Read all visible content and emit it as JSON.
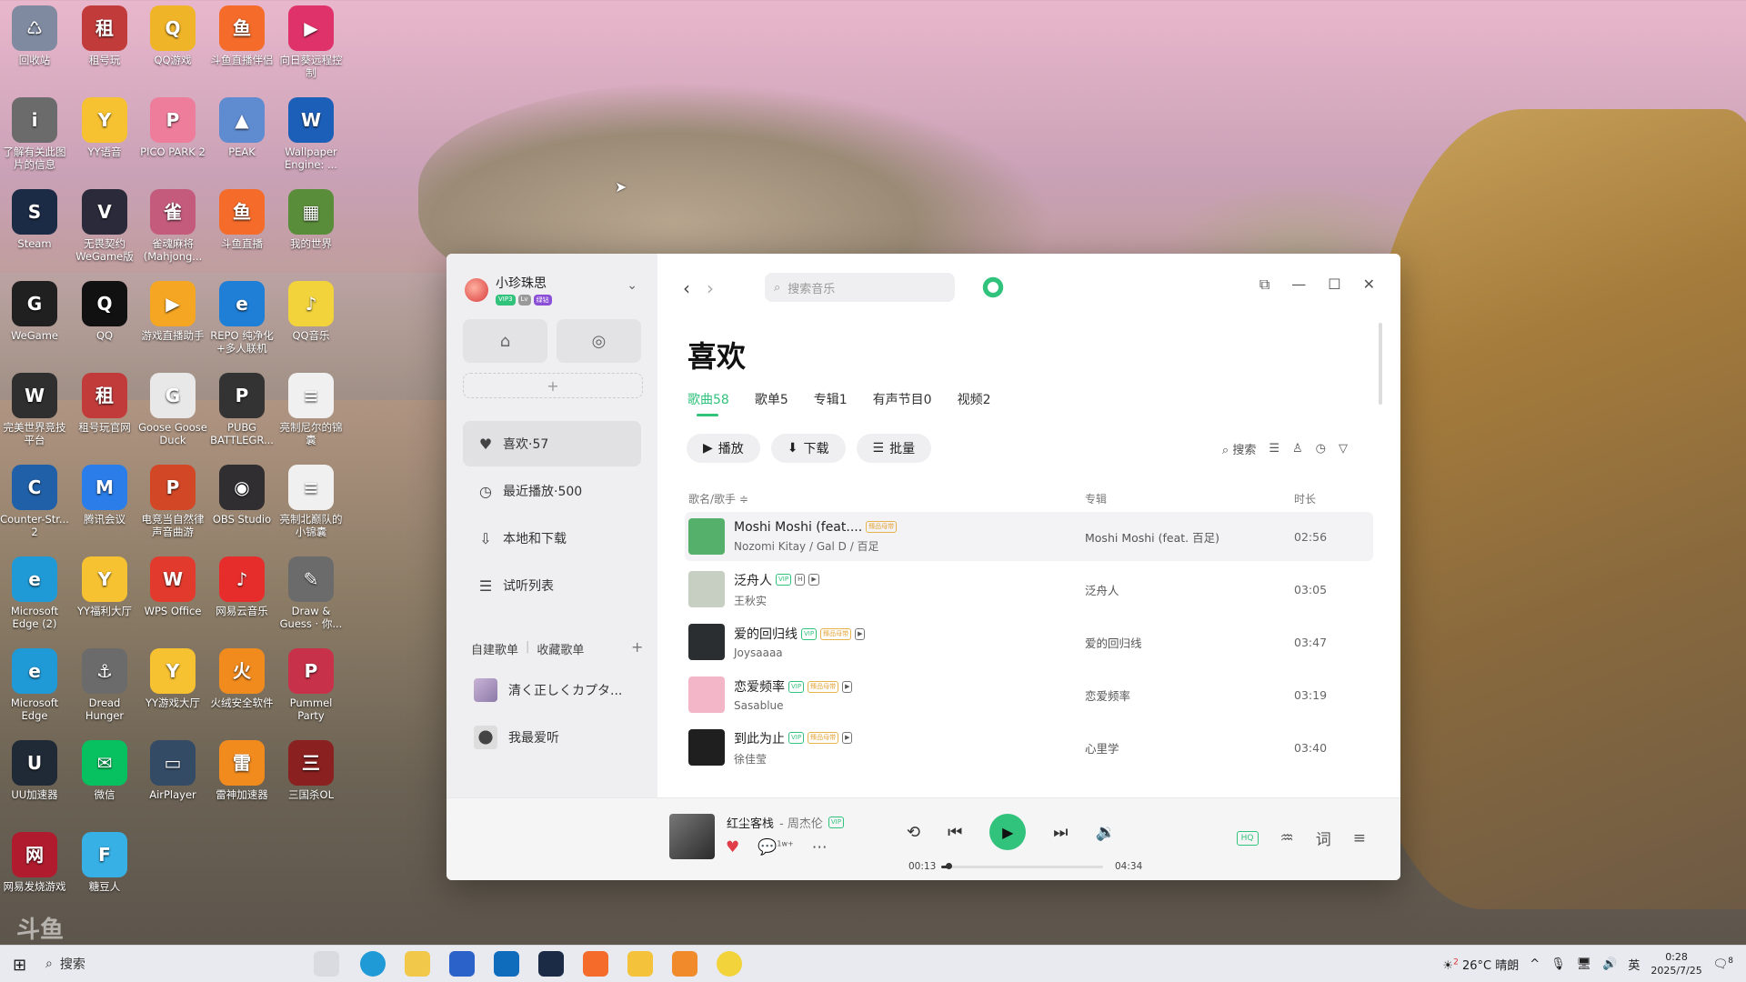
{
  "desktop": {
    "icons": [
      {
        "label": "回收站",
        "color": "#7f8aa1",
        "glyph": "♺"
      },
      {
        "label": "租号玩",
        "color": "#c23b3b",
        "glyph": "租"
      },
      {
        "label": "QQ游戏",
        "color": "#f0b429",
        "glyph": "Q"
      },
      {
        "label": "斗鱼直播伴侣",
        "color": "#f46b2a",
        "glyph": "鱼"
      },
      {
        "label": "向日葵远程控制",
        "color": "#e0326a",
        "glyph": "▶"
      },
      {
        "label": "了解有关此图片的信息",
        "color": "#6b6b6b",
        "glyph": "i"
      },
      {
        "label": "YY语音",
        "color": "#f6c231",
        "glyph": "Y"
      },
      {
        "label": "PICO PARK 2",
        "color": "#ee7d9c",
        "glyph": "P"
      },
      {
        "label": "PEAK",
        "color": "#5f8bd1",
        "glyph": "▲"
      },
      {
        "label": "Wallpaper Engine: ...",
        "color": "#1c5fb8",
        "glyph": "W"
      },
      {
        "label": "Steam",
        "color": "#1b2a45",
        "glyph": "S"
      },
      {
        "label": "无畏契约 WeGame版",
        "color": "#2a2a3a",
        "glyph": "V"
      },
      {
        "label": "雀魂麻将 (Mahjong...",
        "color": "#c45b7d",
        "glyph": "雀"
      },
      {
        "label": "斗鱼直播",
        "color": "#f46b2a",
        "glyph": "鱼"
      },
      {
        "label": "我的世界",
        "color": "#5a8d3a",
        "glyph": "▦"
      },
      {
        "label": "WeGame",
        "color": "#202020",
        "glyph": "G"
      },
      {
        "label": "QQ",
        "color": "#111111",
        "glyph": "Q"
      },
      {
        "label": "游戏直播助手",
        "color": "#f5a623",
        "glyph": "▶"
      },
      {
        "label": "REPO 纯净化+多人联机",
        "color": "#1f7ed6",
        "glyph": "e"
      },
      {
        "label": "QQ音乐",
        "color": "#f2d33b",
        "glyph": "♪"
      },
      {
        "label": "完美世界竞技平台",
        "color": "#2f2f2f",
        "glyph": "W"
      },
      {
        "label": "租号玩官网",
        "color": "#c23b3b",
        "glyph": "租"
      },
      {
        "label": "Goose Goose Duck",
        "color": "#e8e8e8",
        "glyph": "G"
      },
      {
        "label": "PUBG BATTLEGR...",
        "color": "#333333",
        "glyph": "P"
      },
      {
        "label": "亮制尼尔的锦囊",
        "color": "#f0f0f0",
        "glyph": "≡"
      },
      {
        "label": "Counter-Str... 2",
        "color": "#2060a8",
        "glyph": "C"
      },
      {
        "label": "腾讯会议",
        "color": "#2b7de9",
        "glyph": "M"
      },
      {
        "label": "电竞当自然律声音曲游",
        "color": "#d24726",
        "glyph": "P"
      },
      {
        "label": "OBS Studio",
        "color": "#302e31",
        "glyph": "◉"
      },
      {
        "label": "亮制北巅队的小锦囊",
        "color": "#f0f0f0",
        "glyph": "≡"
      },
      {
        "label": "Microsoft Edge (2)",
        "color": "#1f9ad6",
        "glyph": "e"
      },
      {
        "label": "YY福利大厅",
        "color": "#f6c231",
        "glyph": "Y"
      },
      {
        "label": "WPS Office",
        "color": "#e23b2e",
        "glyph": "W"
      },
      {
        "label": "网易云音乐",
        "color": "#e72d2c",
        "glyph": "♪"
      },
      {
        "label": "Draw & Guess · 你...",
        "color": "#6b6b6b",
        "glyph": "✎"
      },
      {
        "label": "Microsoft Edge",
        "color": "#1f9ad6",
        "glyph": "e"
      },
      {
        "label": "Dread Hunger",
        "color": "#6b6b6b",
        "glyph": "⚓"
      },
      {
        "label": "YY游戏大厅",
        "color": "#f6c231",
        "glyph": "Y"
      },
      {
        "label": "火绒安全软件",
        "color": "#f28b1e",
        "glyph": "火"
      },
      {
        "label": "Pummel Party",
        "color": "#c8314a",
        "glyph": "P"
      },
      {
        "label": "UU加速器",
        "color": "#1f2a36",
        "glyph": "U"
      },
      {
        "label": "微信",
        "color": "#07c160",
        "glyph": "✉"
      },
      {
        "label": "AirPlayer",
        "color": "#344b66",
        "glyph": "▭"
      },
      {
        "label": "雷神加速器",
        "color": "#f28b1e",
        "glyph": "雷"
      },
      {
        "label": "三国杀OL",
        "color": "#8a2020",
        "glyph": "三"
      },
      {
        "label": "网易发烧游戏",
        "color": "#b01c2e",
        "glyph": "网"
      },
      {
        "label": "糖豆人",
        "color": "#37b0e6",
        "glyph": "F"
      }
    ],
    "watermark": "斗鱼",
    "watermark_id": "3113116"
  },
  "app": {
    "user": {
      "name": "小珍珠思",
      "badge1": "VIP3",
      "badge2": "Lv",
      "badge3": "绿钻"
    },
    "sidebar": {
      "nav": [
        {
          "label": "喜欢·57",
          "icon": "heart-icon",
          "glyph": "♥"
        },
        {
          "label": "最近播放·500",
          "icon": "clock-icon",
          "glyph": "◷"
        },
        {
          "label": "本地和下载",
          "icon": "download-icon",
          "glyph": "⇩"
        },
        {
          "label": "试听列表",
          "icon": "list-icon",
          "glyph": "☰"
        }
      ],
      "playlist_tabs": {
        "own": "自建歌单",
        "fav": "收藏歌单",
        "sep": "|"
      },
      "playlists": [
        {
          "label": "清く正しくカプタ..."
        },
        {
          "label": "我最爱听"
        }
      ]
    },
    "search_placeholder": "搜索音乐",
    "title": "喜欢",
    "tabs": [
      {
        "label": "歌曲58"
      },
      {
        "label": "歌单5"
      },
      {
        "label": "专辑1"
      },
      {
        "label": "有声节目0"
      },
      {
        "label": "视频2"
      }
    ],
    "actions": {
      "play": "播放",
      "download": "下载",
      "batch": "批量"
    },
    "search_label": "搜索",
    "columns": {
      "song": "歌名/歌手 ≑",
      "album": "专辑",
      "duration": "时长"
    },
    "songs": [
      {
        "title": "Moshi Moshi (feat....",
        "artist": "Nozomi Kitay / Gal D / 百足",
        "album": "Moshi Moshi (feat. 百足)",
        "duration": "02:56",
        "color": "#55b06b",
        "tags": [
          "臻品母带"
        ]
      },
      {
        "title": "泛舟人",
        "artist": "王秋实",
        "album": "泛舟人",
        "duration": "03:05",
        "color": "#c7cec2",
        "tags": [
          "VIP",
          "H",
          "▶"
        ]
      },
      {
        "title": "爱的回归线",
        "artist": "Joysaaaa",
        "album": "爱的回归线",
        "duration": "03:47",
        "color": "#2a2e30",
        "tags": [
          "VIP",
          "臻品母带",
          "▶"
        ]
      },
      {
        "title": "恋爱频率",
        "artist": "Sasablue",
        "album": "恋爱频率",
        "duration": "03:19",
        "color": "#f3b5c8",
        "tags": [
          "VIP",
          "臻品母带",
          "▶"
        ]
      },
      {
        "title": "到此为止",
        "artist": "徐佳莹",
        "album": "心里学",
        "duration": "03:40",
        "color": "#1f1f1f",
        "tags": [
          "VIP",
          "臻品母带",
          "▶"
        ]
      }
    ],
    "player": {
      "title": "红尘客栈",
      "artist": "- 周杰伦",
      "vip": "VIP",
      "comment_count": "1w+",
      "current": "00:13",
      "total": "04:34",
      "progress": 0.047,
      "hq": "HQ"
    }
  },
  "taskbar": {
    "search": "搜索",
    "weather_badge": "2",
    "weather": "26°C 晴朗",
    "lang": "英",
    "time": "0:28",
    "date": "2025/7/25",
    "notif": "8"
  }
}
